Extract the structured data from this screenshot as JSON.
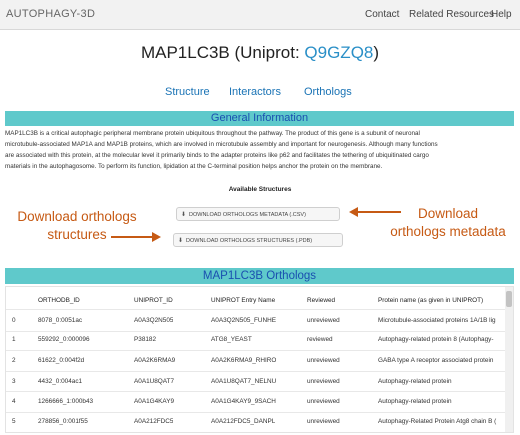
{
  "nav": {
    "brand": "AUTOPHAGY-3D",
    "links": [
      "Contact",
      "Related Resources",
      "Help"
    ]
  },
  "header": {
    "title_prefix": "MAP1LC3B (Uniprot: ",
    "accession": "Q9GZQ8",
    "title_suffix": ")"
  },
  "tabs": [
    "Structure",
    "Interactors",
    "Orthologs"
  ],
  "general": {
    "heading": "General Information",
    "lines": [
      "MAP1LC3B is a critical autophagic peripheral membrane protein ubiquitous throughout the pathway. The product of this gene is a subunit of neuronal",
      "microtubule-associated MAP1A and MAP1B proteins, which are involved in microtubule assembly and important for neurogenesis. Although many functions",
      "are associated with this protein, at the molecular level it primarily binds to the adapter proteins like p62 and facilitates the tethering of ubiquitinated cargo",
      "materials in the autophagosome. To perform its function, lipidation at the C-terminal position helps anchor the protein on the membrane."
    ]
  },
  "structures": {
    "heading": "Available Structures",
    "metadata_button": "DOWNLOAD ORTHOLOGS METADATA (.CSV)",
    "structures_button": "DOWNLOAD ORTHOLOGS STRUCTURES (.PDB)",
    "download_icon": "download-icon"
  },
  "annotations": {
    "left_line1": "Download orthologs",
    "left_line2": "structures",
    "right_line1": "Download",
    "right_line2": "orthologs metadata",
    "color": "#c65a14"
  },
  "orthologs": {
    "heading": "MAP1LC3B Orthologs",
    "columns": [
      "",
      "ORTHODB_ID",
      "UNIPROT_ID",
      "UNIPROT Entry Name",
      "Reviewed",
      "Protein name (as given in UNIPROT)"
    ],
    "rows": [
      [
        "0",
        "8078_0:0051ac",
        "A0A3Q2N505",
        "A0A3Q2N505_FUNHE",
        "unreviewed",
        "Microtubule-associated proteins 1A/1B lig"
      ],
      [
        "1",
        "559292_0:000096",
        "P38182",
        "ATG8_YEAST",
        "reviewed",
        "Autophagy-related protein 8 (Autophagy-"
      ],
      [
        "2",
        "61622_0:004f2d",
        "A0A2K6RMA9",
        "A0A2K6RMA9_RHIRO",
        "unreviewed",
        "GABA type A receptor associated protein"
      ],
      [
        "3",
        "4432_0:004ac1",
        "A0A1U8QAT7",
        "A0A1U8QAT7_NELNU",
        "unreviewed",
        "Autophagy-related protein"
      ],
      [
        "4",
        "1266666_1:000b43",
        "A0A1G4KAY9",
        "A0A1G4KAY9_9SACH",
        "unreviewed",
        "Autophagy-related protein"
      ],
      [
        "5",
        "278856_0:001f55",
        "A0A212FDC5",
        "A0A212FDC5_DANPL",
        "unreviewed",
        "Autophagy-Related Protein Atg8 chain B ("
      ]
    ]
  },
  "colors": {
    "section_bar": "#5fc9cb",
    "section_text": "#1a4fb0",
    "link": "#1a73b5",
    "accent": "#2a8fc7"
  }
}
